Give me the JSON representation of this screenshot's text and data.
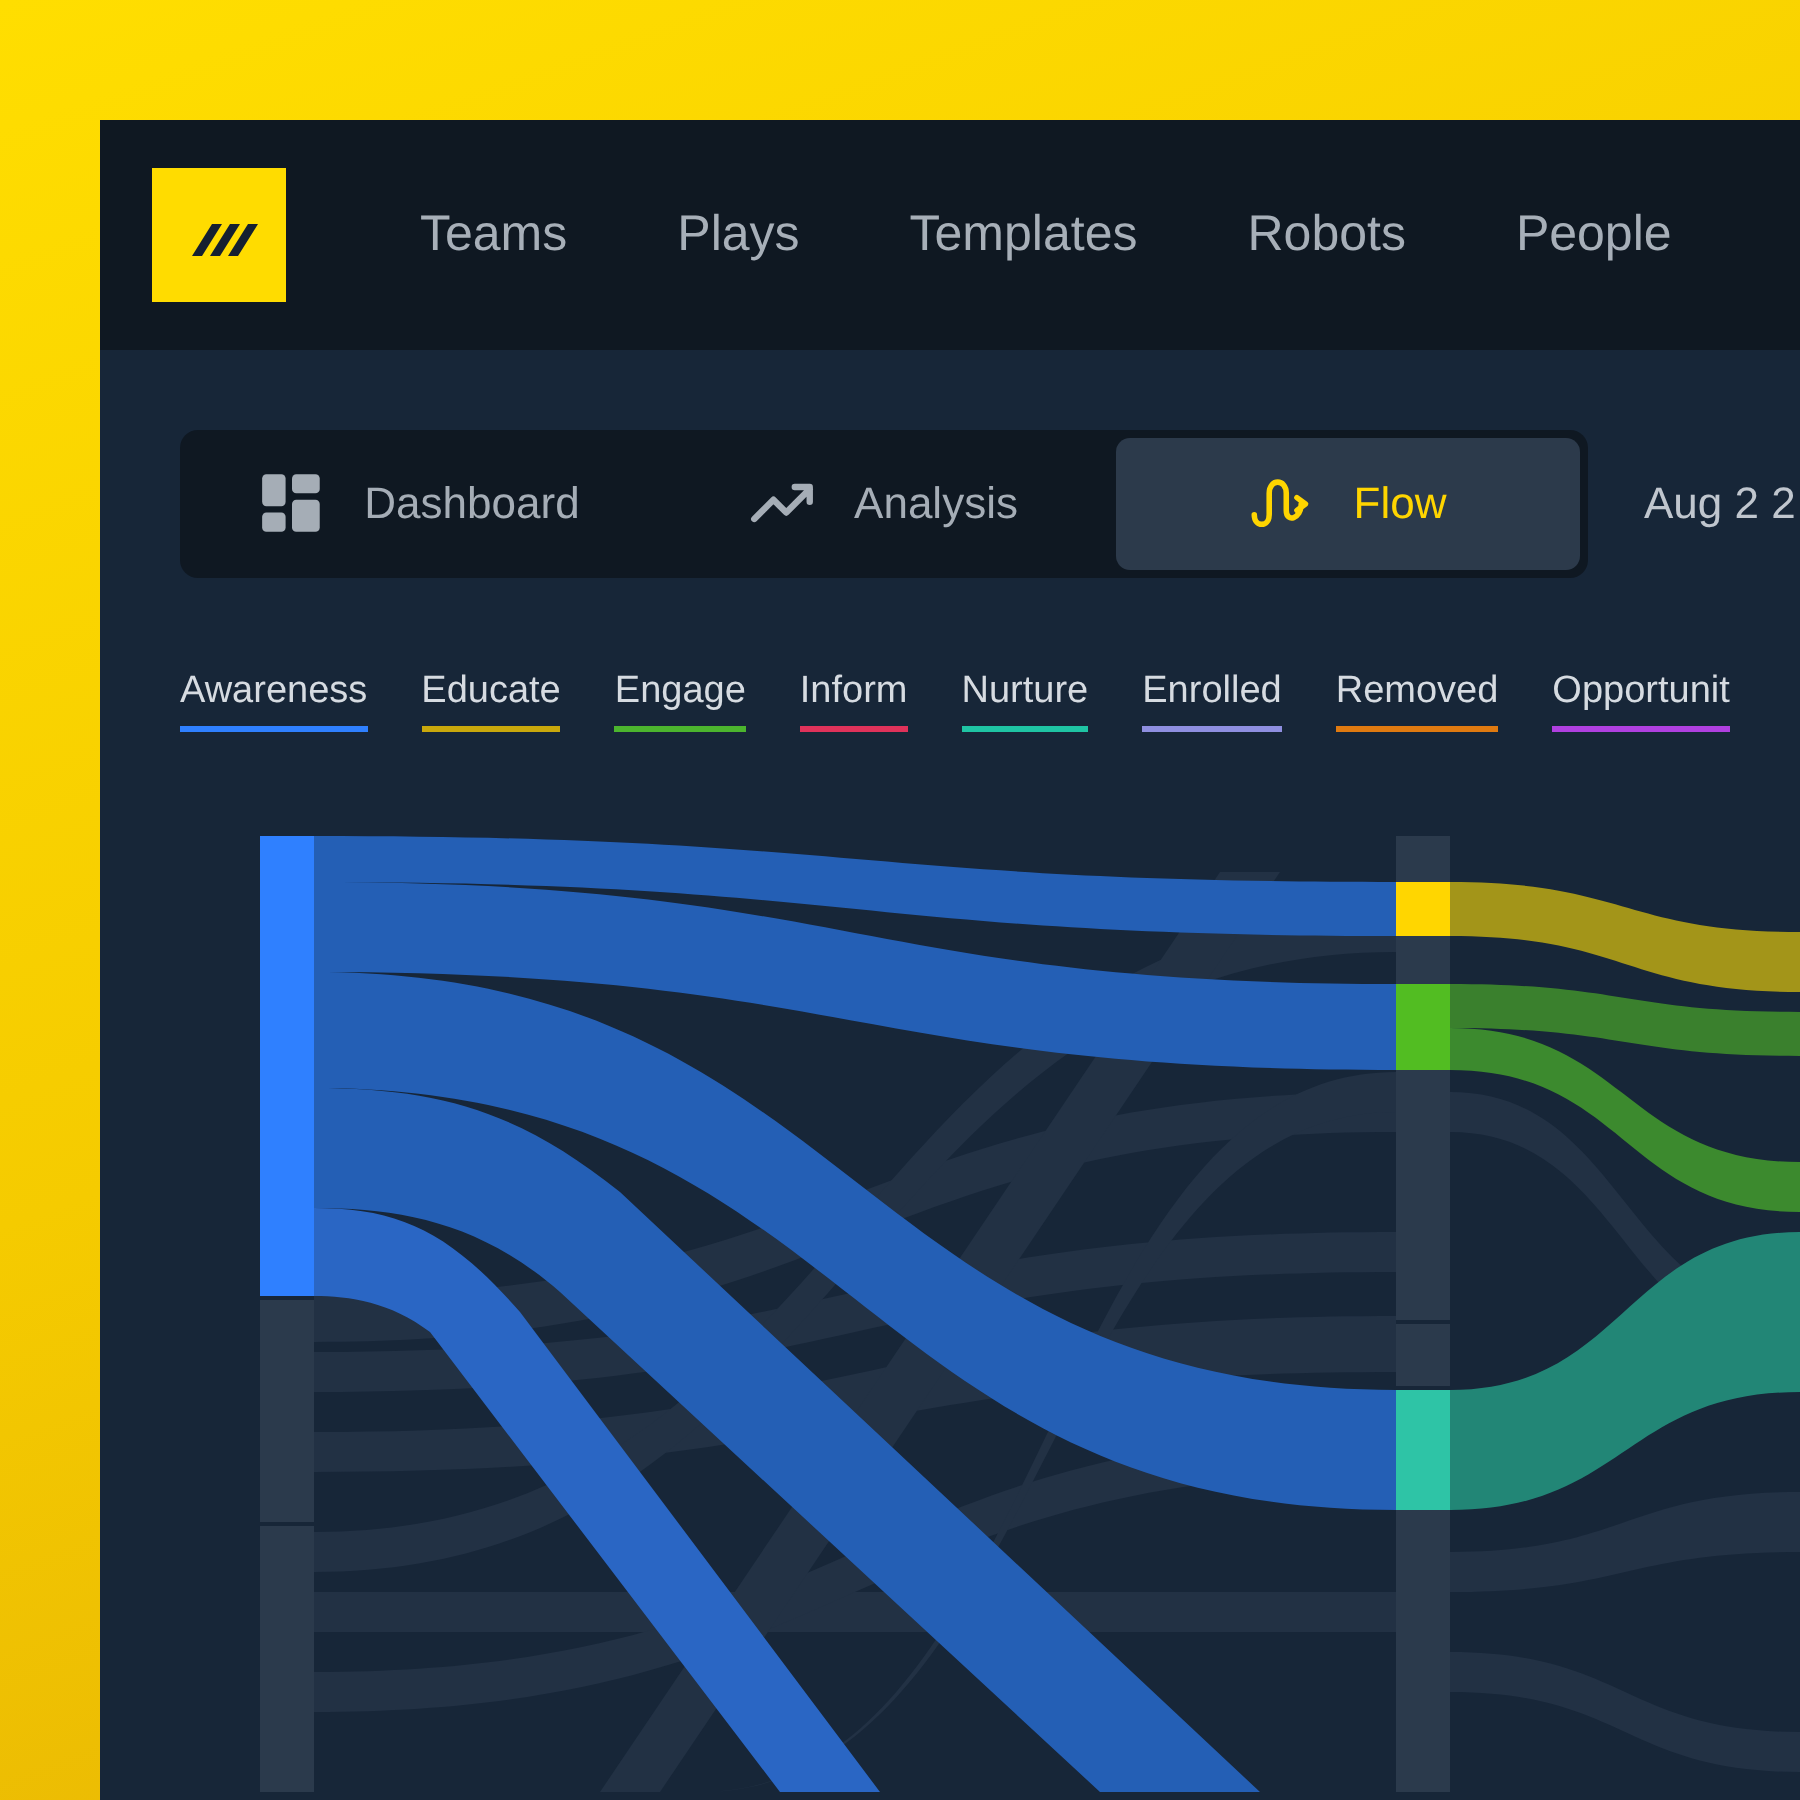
{
  "nav": [
    {
      "label": "Teams"
    },
    {
      "label": "Plays"
    },
    {
      "label": "Templates"
    },
    {
      "label": "Robots"
    },
    {
      "label": "People"
    }
  ],
  "tabs": [
    {
      "label": "Dashboard",
      "selected": false
    },
    {
      "label": "Analysis",
      "selected": false
    },
    {
      "label": "Flow",
      "selected": true
    }
  ],
  "date": "Aug 2 2",
  "legend": [
    {
      "label": "Awareness",
      "color": "#2f80ff"
    },
    {
      "label": "Educate",
      "color": "#c9a80c"
    },
    {
      "label": "Engage",
      "color": "#4cb52e"
    },
    {
      "label": "Inform",
      "color": "#e0325a"
    },
    {
      "label": "Nurture",
      "color": "#1fc4a4"
    },
    {
      "label": "Enrolled",
      "color": "#8f8fe0"
    },
    {
      "label": "Removed",
      "color": "#e07a10"
    },
    {
      "label": "Opportunit",
      "color": "#b040e0"
    }
  ]
}
